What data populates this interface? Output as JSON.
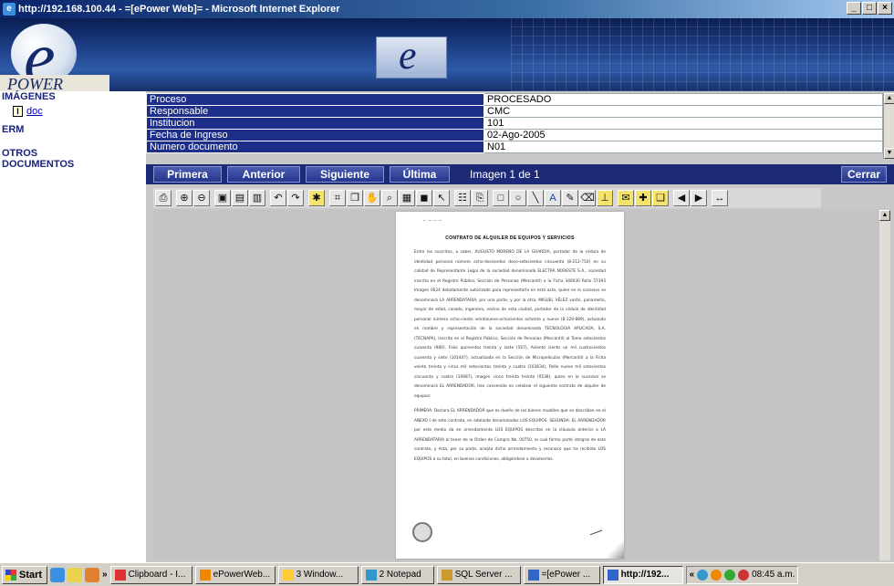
{
  "window": {
    "title": "http://192.168.100.44 - =[ePower Web]= - Microsoft Internet Explorer",
    "controls": [
      "_",
      "□",
      "×"
    ]
  },
  "banner": {
    "logo_letter": "e",
    "logo_text": "POWER"
  },
  "sidebar": {
    "items": [
      {
        "label": "IMÁGENES"
      },
      {
        "label": "ERM"
      },
      {
        "label": "OTROS DOCUMENTOS"
      }
    ],
    "sub_item": {
      "label": "doc",
      "icon": "document-icon"
    }
  },
  "metadata": {
    "rows": [
      {
        "key": "Proceso",
        "value": "PROCESADO"
      },
      {
        "key": "Responsable",
        "value": "CMC"
      },
      {
        "key": "Institucion",
        "value": "101"
      },
      {
        "key": "Fecha de Ingreso",
        "value": "02-Ago-2005"
      },
      {
        "key": "Numero documento",
        "value": "N01"
      }
    ]
  },
  "navigation": {
    "first": "Primera",
    "prev": "Anterior",
    "next": "Siguiente",
    "last": "Última",
    "image_count": "Imagen 1 de 1",
    "close": "Cerrar"
  },
  "toolbar": {
    "icons": [
      "print-icon",
      "zoom-in-icon",
      "zoom-out-icon",
      "fit-page-icon",
      "fit-width-icon",
      "actual-size-icon",
      "rotate-left-icon",
      "rotate-right-icon",
      "invert-icon",
      "select-icon",
      "copy-icon",
      "hand-icon",
      "magnify-icon",
      "thumbnail-icon",
      "stamp-icon",
      "pointer-icon",
      "properties-icon",
      "scan-icon",
      "rectangle-icon",
      "ellipse-icon",
      "line-icon",
      "text-icon",
      "highlighter-icon",
      "eraser-icon",
      "underline-icon",
      "note-icon",
      "annotation-icon",
      "annotation-2-icon",
      "prev-page-icon",
      "next-page-icon",
      "resize-icon"
    ]
  },
  "document": {
    "title": "CONTRATO DE ALQUILER DE EQUIPOS Y SERVICIOS",
    "paragraph1": "Entre los suscritos, a saber, AUGUSTO MORENO DE LA GUARDIA, portador de la cédula de identidad personal número ocho-doscientos doce-setecientos cincuenta (8-212-750) en su calidad de Representante Legal de la sociedad denominada ELECTRA NORESTE S.A., sociedad inscrita en el Registro Público, Sección de Personas (Mercantil) a la Ficha 340030 Rollo 57393 Imagen 0024 debidamente autorizado para representarla en este acto, quien en lo sucesivo se denominará LA ARRENDATARIA, por una parte, y por la otra, MIGUEL VÉLEZ varón, panameño, mayor de edad, casado, ingeniero, vecino de esta ciudad, portador de la cédula de identidad personal número ocho-ciento veintinueve-ochocientos ochenta y nueve (8-129-889), actuando en nombre y representación de la sociedad denominada TECNOLOGIA APLICADA, S.A. (TECNAPA), inscrita en el Registro Público, Sección de Personas (Mercantil) al Tomo setecientos cuarenta (980), Folio quinientos treinta y siete (567), Asiento ciento un mil cuatrocientos cuarenta y siete (101447), actualizada en la Sección de Micropelículas (Mercantil) a la Ficha veinte treinta y cinco mil setecientos treinta y cuatro (103634), Rollo nueve mil setecientos cincuenta y cuatro (10687), imagen cinco treinta treinta (0538), quien en lo sucesivo se denominará EL ARRENDADOR, han convenido en celebrar el siguiente contrato de alquiler de equipos:",
    "paragraph2": "PRIMERA: Declara EL ARRENDADOR que es dueño de los bienes muebles que se describen en el ANEXO I de este contrato, en adelante denominados LOS EQUIPOS. SEGUNDA: EL ARRENDADOR por este medio da en arrendamiento LOS EQUIPOS descritos en la cláusula anterior a LA ARRENDATARIA al tenor de la Orden de Compra No. 00750, la cual forma parte integral de este contrato, y ésta, por su parte, acepta dicho arrendamiento y reconoce que ha recibido LOS EQUIPOS a su total, en buenas condiciones, obligándose a devolverlos."
  },
  "taskbar": {
    "start": "Start",
    "tasks": [
      {
        "label": "Clipboard - I...",
        "color": "#d33"
      },
      {
        "label": "ePowerWeb...",
        "color": "#e80"
      },
      {
        "label": "3 Window...",
        "color": "#fc3"
      },
      {
        "label": "2 Notepad",
        "color": "#39c"
      },
      {
        "label": "SQL Server ...",
        "color": "#c93"
      },
      {
        "label": "=[ePower ...",
        "color": "#36c"
      },
      {
        "label": "http://192...",
        "color": "#36c",
        "active": true
      }
    ],
    "clock": "08:45 a.m."
  }
}
